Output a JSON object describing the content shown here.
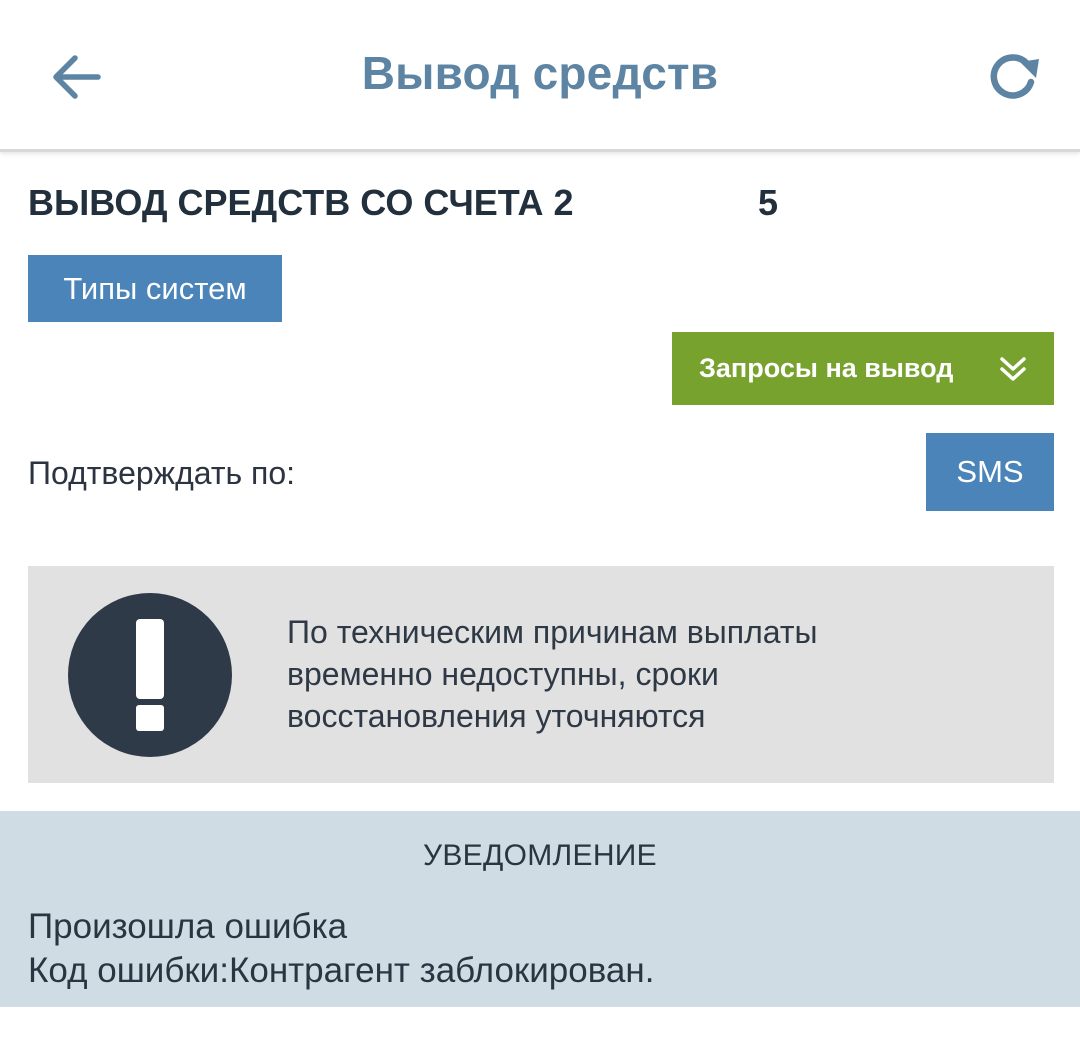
{
  "header": {
    "title": "Вывод средств",
    "back_icon": "arrow-left-icon",
    "refresh_icon": "refresh-icon"
  },
  "account": {
    "title": "ВЫВОД СРЕДСТВ СО СЧЕТА 2",
    "number_fragment": "5"
  },
  "buttons": {
    "system_types": "Типы систем",
    "withdrawal_requests": "Запросы на вывод",
    "sms": "SMS"
  },
  "confirm": {
    "label": "Подтверждать по:"
  },
  "alert": {
    "icon": "exclamation-circle-icon",
    "line1": "По техническим причинам выплаты",
    "line2": "временно недоступны, сроки",
    "line3": "восстановления уточняются"
  },
  "notice": {
    "title": "УВЕДОМЛЕНИЕ",
    "line1": "Произошла ошибка",
    "line2": "Код ошибки:Контрагент заблокирован."
  },
  "colors": {
    "header_title": "#5d84a2",
    "blue_button": "#4a84b8",
    "green_button": "#77a22e",
    "alert_bg": "#e1e1e1",
    "notice_bg": "#d0dce4",
    "dark_text": "#222f3d"
  }
}
